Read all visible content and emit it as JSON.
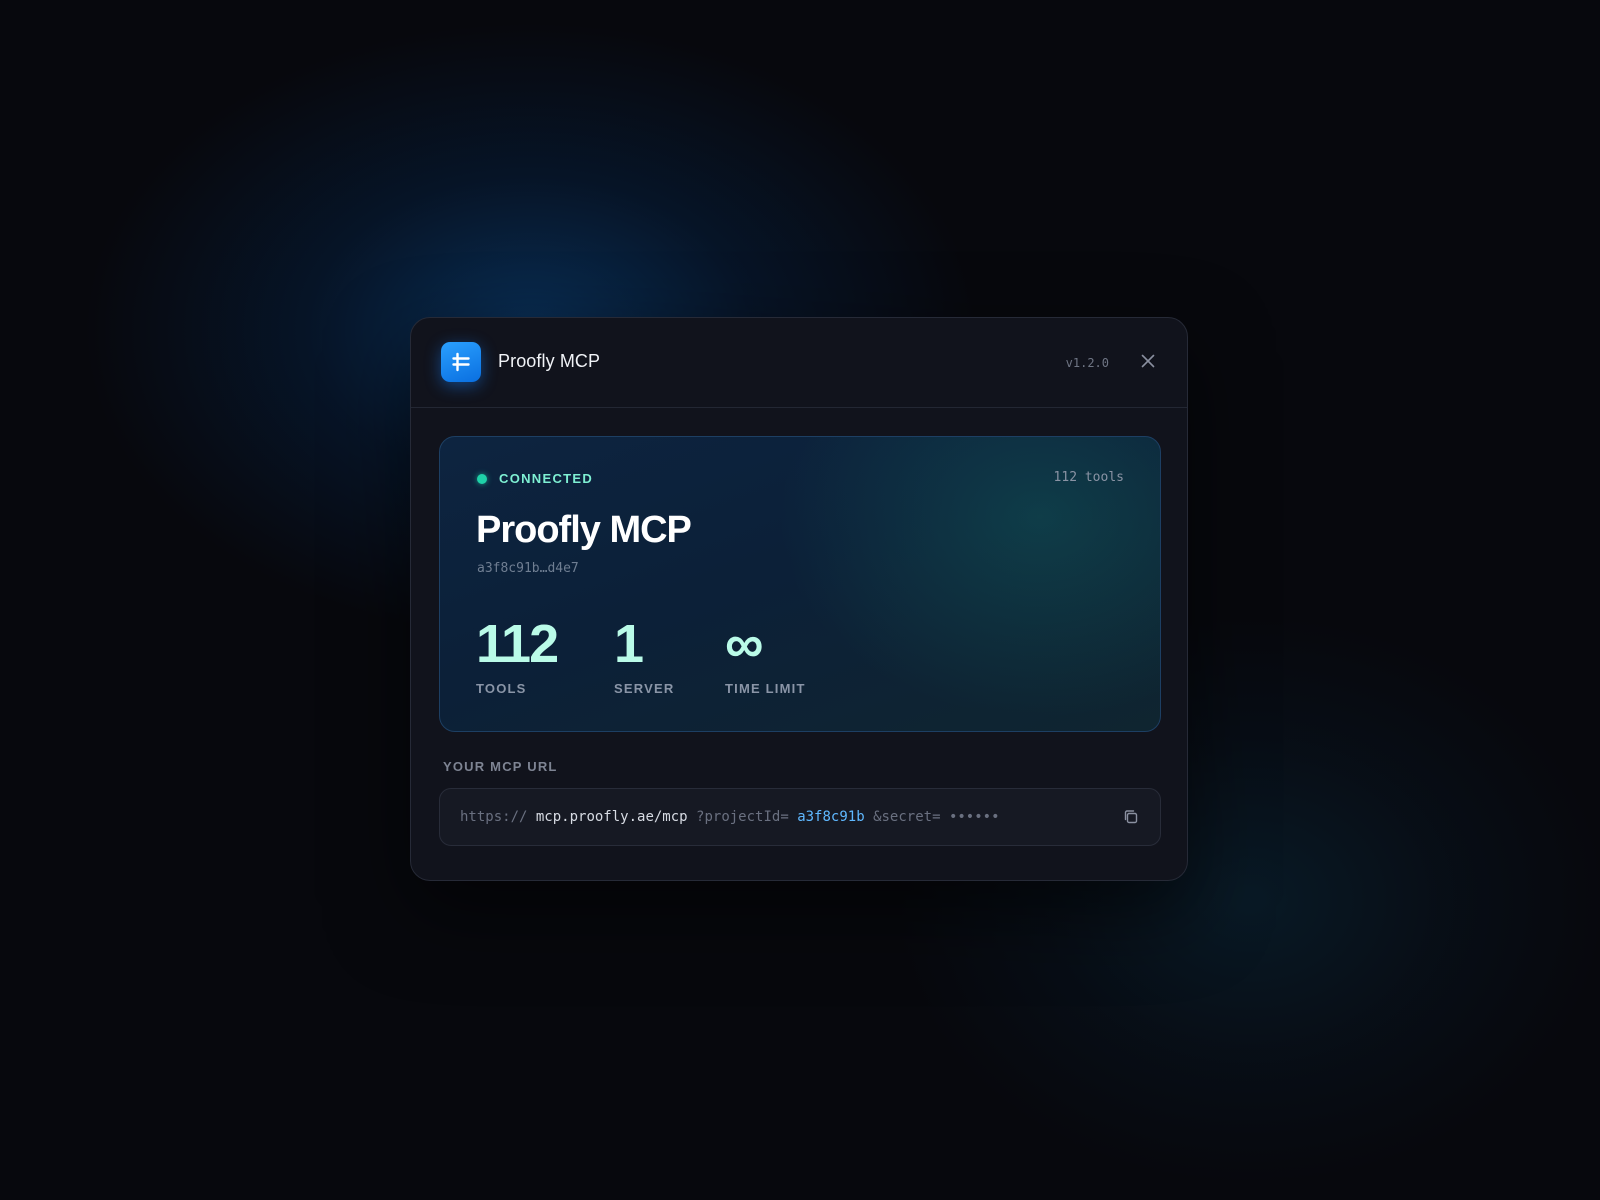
{
  "header": {
    "app_title": "Proofly MCP",
    "version": "v1.2.0",
    "icons": {
      "app": "app-logo-icon",
      "close": "close-icon"
    }
  },
  "status_card": {
    "status": "CONNECTED",
    "status_color": "#1fd1a8",
    "tools_count": "112 tools",
    "server_name": "Proofly MCP",
    "server_id": "a3f8c91b…d4e7",
    "stats": [
      {
        "value": "112",
        "label": "TOOLS"
      },
      {
        "value": "1",
        "label": "SERVER"
      },
      {
        "value": "∞",
        "label": "TIME LIMIT"
      }
    ]
  },
  "mcp_url": {
    "label": "YOUR MCP URL",
    "scheme": "https://",
    "host_path": "mcp.proofly.ae/mcp",
    "project_param": "?projectId=",
    "project_id": "a3f8c91b",
    "secret_param": "&secret=",
    "secret_masked": "••••••",
    "copy_icon": "copy-icon"
  },
  "colors": {
    "background": "#07080d",
    "modal": "#11131c",
    "accent_blue": "#5fb8ff",
    "stat_value": "#bafbe8"
  }
}
